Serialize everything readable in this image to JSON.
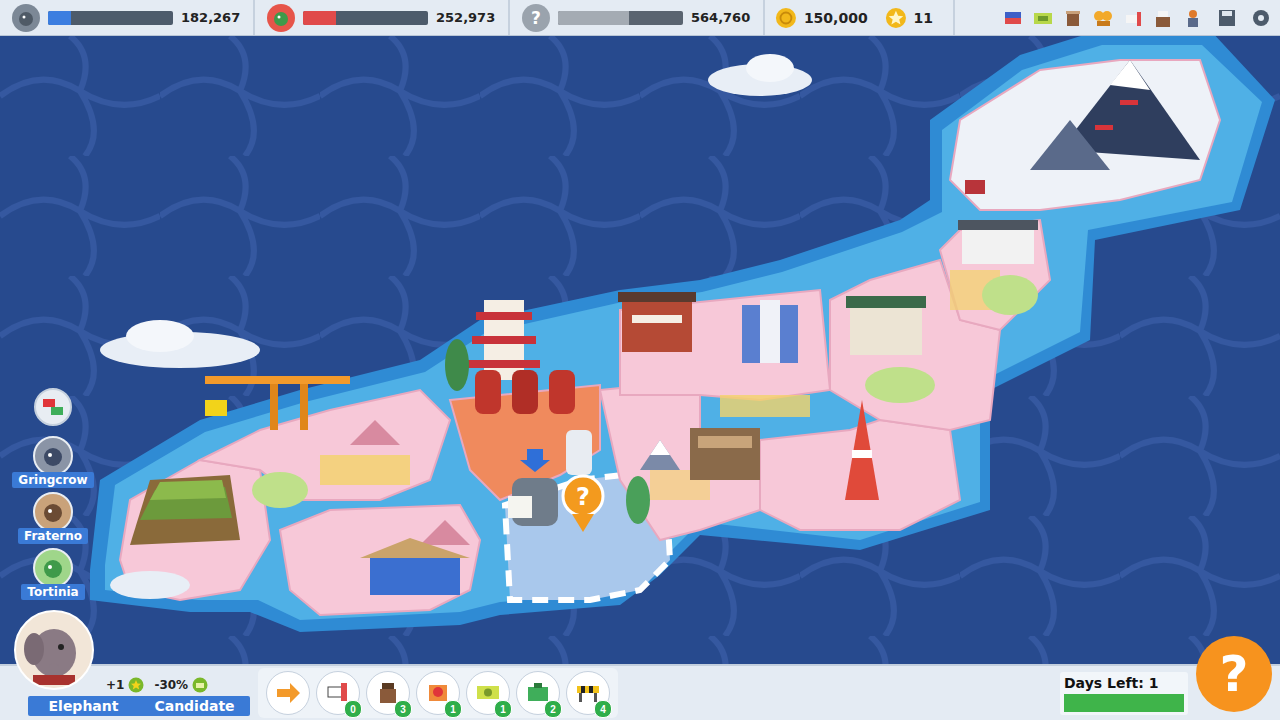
{
  "top_bar": {
    "candidates": [
      {
        "kind": "elephant",
        "score": "182,267",
        "level": 0.18,
        "color": "#3c7ee0"
      },
      {
        "kind": "crocodile",
        "score": "252,973",
        "level": 0.26,
        "color": "#e04a4a"
      },
      {
        "kind": "mystery",
        "mark": "?",
        "score": "564,760",
        "level": 0.57,
        "color": "#a4abb3"
      }
    ],
    "coins": "150,000",
    "stars": "11"
  },
  "map": {
    "districts": [
      {
        "color": "#f7c8d8",
        "selected": false
      },
      {
        "color": "#f7c8d8",
        "selected": false
      },
      {
        "color": "#f08a5d",
        "selected": false
      },
      {
        "color": "#f7c8d8",
        "selected": false
      },
      {
        "color": "#a9c8ec",
        "selected": true
      },
      {
        "color": "#f7c8d8",
        "selected": false
      },
      {
        "color": "#f7c8d8",
        "selected": false
      },
      {
        "color": "#f7c8d8",
        "selected": false
      },
      {
        "color": "#f7c8d8",
        "selected": false
      },
      {
        "color": "#f7c8d8",
        "selected": false
      },
      {
        "color": "#eef2f8",
        "selected": false
      }
    ],
    "pin_label": "?"
  },
  "rivals": [
    {
      "name": "Gringcrow",
      "kind": "crow"
    },
    {
      "name": "Fraterno",
      "kind": "platypus"
    },
    {
      "name": "Tortinia",
      "kind": "turtle"
    }
  ],
  "player": {
    "name": "Elephant",
    "role": "Candidate",
    "star_bonus": "+1",
    "money_modifier": "-30%"
  },
  "actions": [
    {
      "kind": "speech",
      "count": "0"
    },
    {
      "kind": "podium",
      "count": "3"
    },
    {
      "kind": "charity",
      "count": "1"
    },
    {
      "kind": "money",
      "count": "1"
    },
    {
      "kind": "briefcase",
      "count": "2"
    },
    {
      "kind": "barrier",
      "count": "4"
    }
  ],
  "days": {
    "label": "Days Left: 1",
    "level": 1
  },
  "help_button": "?"
}
